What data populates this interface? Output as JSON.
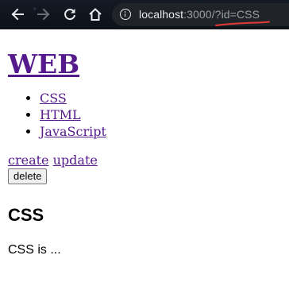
{
  "browser": {
    "url_host": "localhost",
    "url_rest": ":3000/?id=CSS",
    "colors": {
      "chrome_bg": "#111620",
      "address_bg": "#202428",
      "icon": "#e8eaed",
      "url_dim": "#9aa0a6",
      "annotation": "#e53935"
    }
  },
  "page": {
    "title": "WEB",
    "topics": [
      "CSS",
      "HTML",
      "JavaScript"
    ],
    "actions": {
      "create": "create",
      "update": "update",
      "delete": "delete"
    },
    "article": {
      "title": "CSS",
      "body": "CSS is ..."
    },
    "colors": {
      "link": "#551a8b"
    }
  }
}
